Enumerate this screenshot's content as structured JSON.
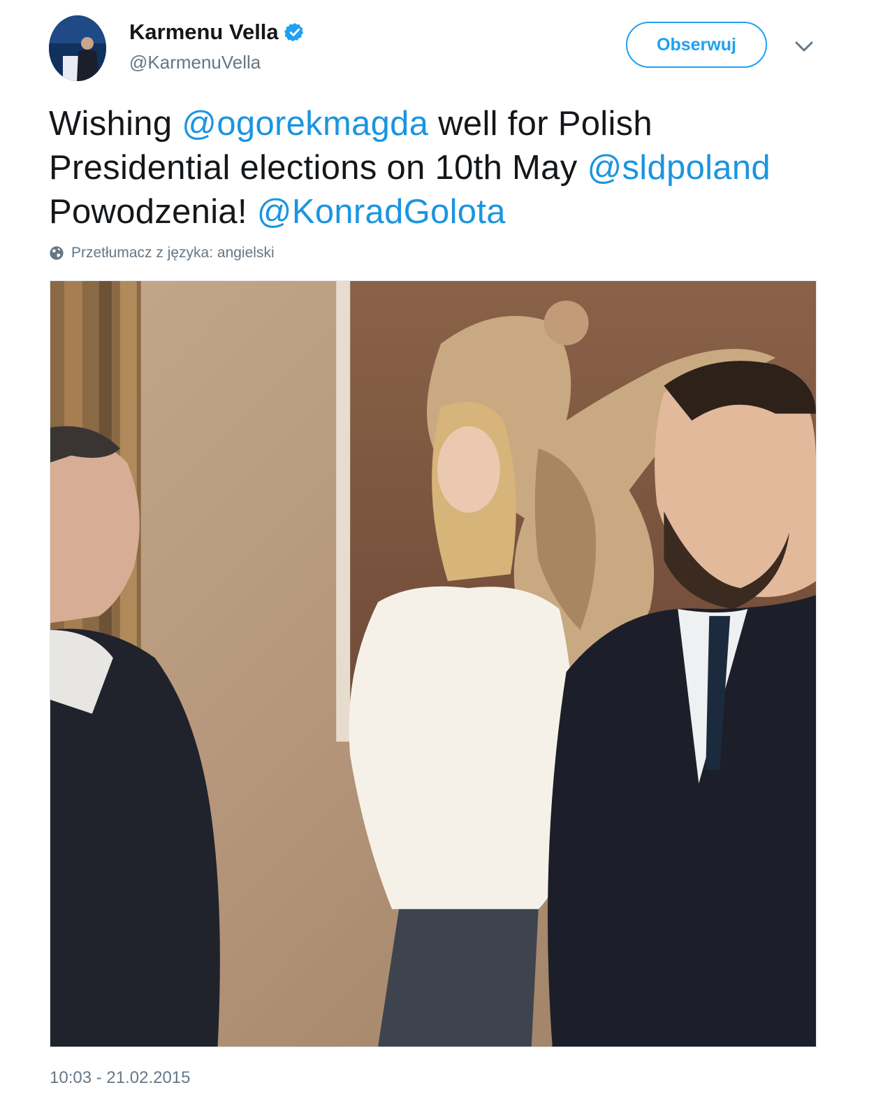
{
  "author": {
    "display_name": "Karmenu Vella",
    "handle": "@KarmenuVella",
    "verified": true,
    "avatar_icon": "user-avatar"
  },
  "actions": {
    "follow_label": "Obserwuj",
    "more_icon": "chevron-down-icon"
  },
  "tweet": {
    "parts": [
      {
        "text": "Wishing ",
        "mention": false
      },
      {
        "text": "@ogorekmagda",
        "mention": true
      },
      {
        "text": " well for Polish Presidential elections on 10th May ",
        "mention": false
      },
      {
        "text": "@sldpoland",
        "mention": true
      },
      {
        "text": " Powodzenia! ",
        "mention": false
      },
      {
        "text": "@KonradGolota",
        "mention": true
      }
    ],
    "translate_label": "Przetłumacz z języka: angielski",
    "timestamp": "10:03 - 21.02.2015"
  },
  "colors": {
    "accent": "#1da1f2",
    "mention": "#1b95e0",
    "secondary_text": "#657786",
    "text": "#14171a"
  }
}
